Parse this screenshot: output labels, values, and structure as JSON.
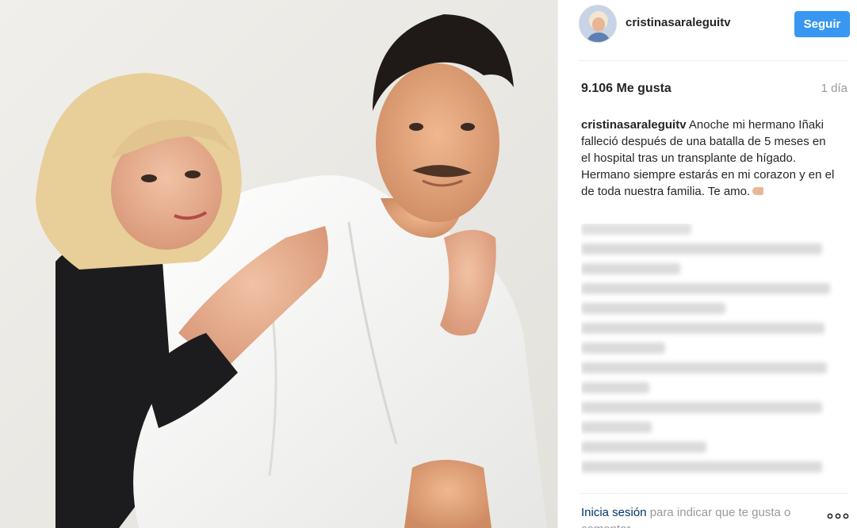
{
  "post": {
    "username": "cristinasaraleguitv",
    "follow_label": "Seguir",
    "likes": "9.106 Me gusta",
    "time": "1 día",
    "caption_user": "cristinasaraleguitv",
    "caption_text": " Anoche mi hermano Iñaki falleció después de una batalla de 5 meses en el hospital tras un transplante de hígado. Hermano siempre estarás en mi corazon y en el de toda nuestra familia. Te amo.",
    "login_link": "Inicia sesión",
    "login_text": " para indicar que te gusta o comentar."
  },
  "colors": {
    "follow_button": "#3897f0",
    "link": "#003569",
    "muted_text": "#999999"
  },
  "icons": {
    "more": "more-options-icon",
    "hand_emoji": "pointing-hand-emoji"
  }
}
